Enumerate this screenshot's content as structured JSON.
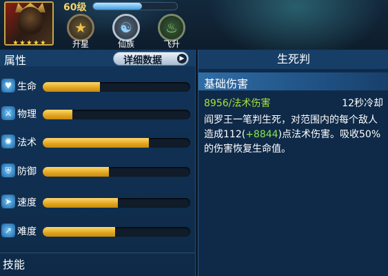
{
  "header": {
    "level": "60级",
    "xp_fill_fraction": 0.58,
    "stars": "★★★★★",
    "tabs": [
      {
        "label": "升星",
        "icon": "star-icon"
      },
      {
        "label": "仙族",
        "icon": "yin-yang-icon"
      },
      {
        "label": "飞升",
        "icon": "flame-icon"
      }
    ]
  },
  "attributes": {
    "title": "属性",
    "detail_button": "详细数据",
    "stats": [
      {
        "label": "生命",
        "icon": "heart-icon",
        "fill": 0.39
      },
      {
        "label": "物理",
        "icon": "sword-icon",
        "fill": 0.2
      },
      {
        "label": "法术",
        "icon": "magic-swirl-icon",
        "fill": 0.72
      },
      {
        "label": "防御",
        "icon": "shield-icon",
        "fill": 0.45
      },
      {
        "label": "速度",
        "icon": "boot-icon",
        "fill": 0.51
      },
      {
        "label": "难度",
        "icon": "trend-icon",
        "fill": 0.49
      }
    ],
    "skills_title": "技能"
  },
  "skill": {
    "name": "生死判",
    "category": "基础伤害",
    "damage": "8956/法术伤害",
    "cooldown": "12秒冷却",
    "desc_part1": "阎罗王一笔判生死，对范围内的每个敌人造成112(",
    "desc_highlight": "+8844",
    "desc_part2": ")点法术伤害。吸收50%的伤害恢复生命值。"
  },
  "colors": {
    "bar_fill": "#e0a41e",
    "highlight_green": "#8de34a",
    "panel_blue": "#163e66"
  }
}
